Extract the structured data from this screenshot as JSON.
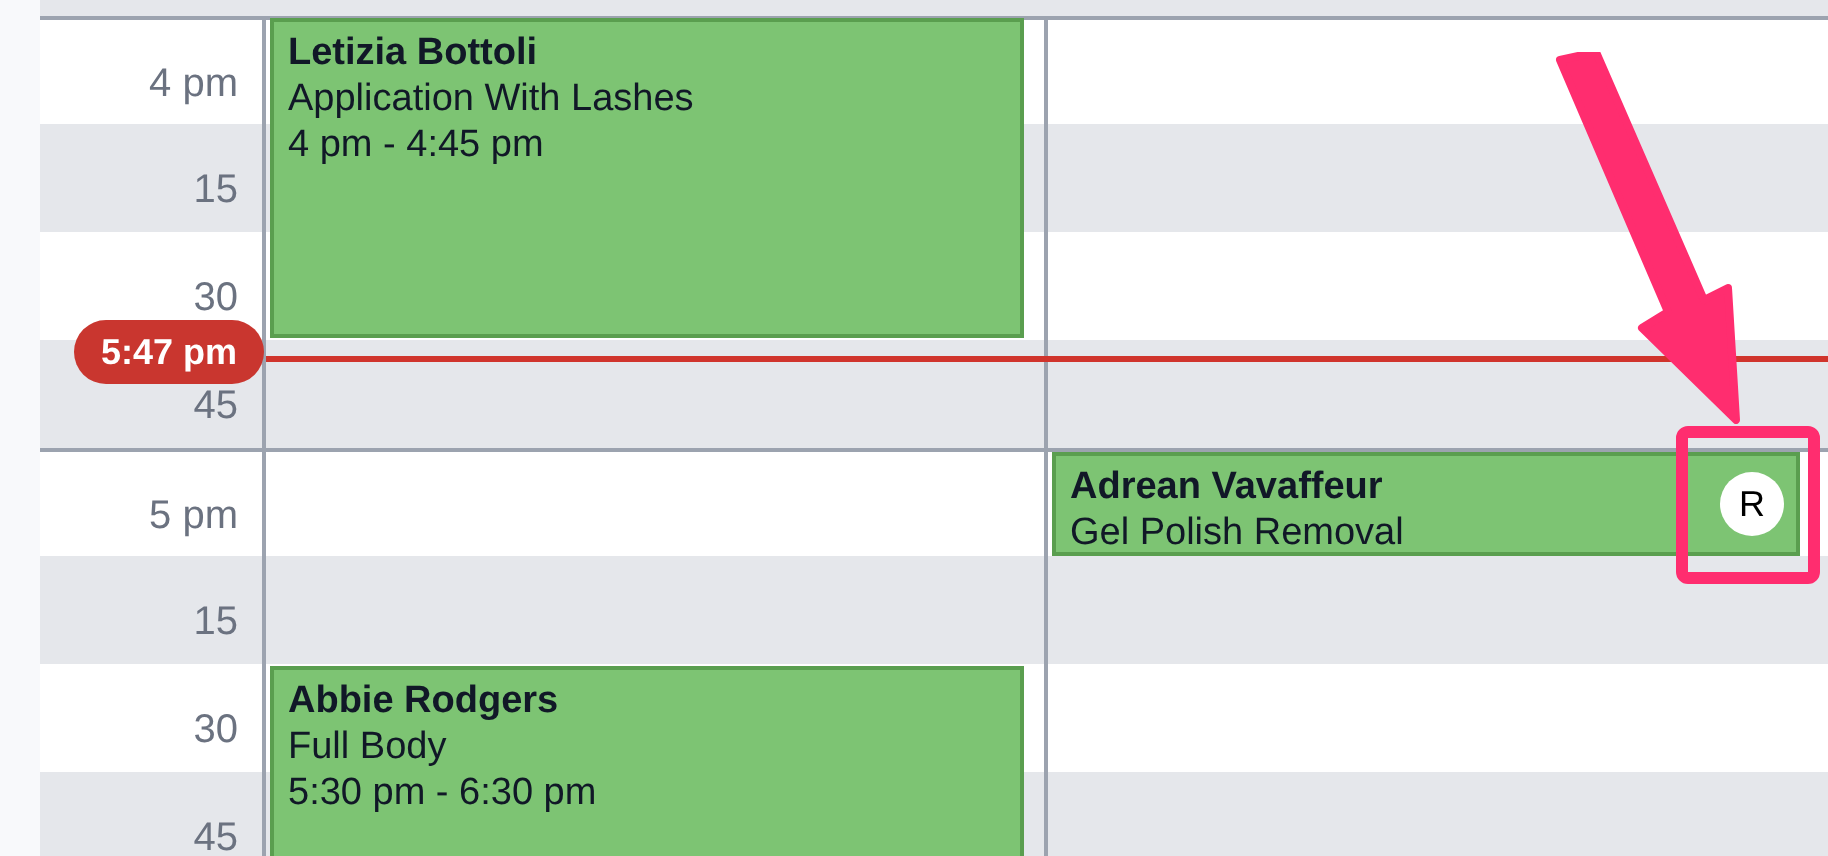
{
  "time_slots": [
    {
      "label": "4 pm",
      "kind": "hour"
    },
    {
      "label": "15",
      "kind": "quarter"
    },
    {
      "label": "30",
      "kind": "quarter"
    },
    {
      "label": "45",
      "kind": "quarter"
    },
    {
      "label": "5 pm",
      "kind": "hour"
    },
    {
      "label": "15",
      "kind": "quarter"
    },
    {
      "label": "30",
      "kind": "quarter"
    },
    {
      "label": "45",
      "kind": "quarter"
    }
  ],
  "now_marker": "5:47 pm",
  "appointments": [
    {
      "client": "Letizia Bottoli",
      "service": "Application With Lashes",
      "time": "4 pm - 4:45 pm"
    },
    {
      "client": "Adrean Vavaffeur",
      "service": "Gel Polish Removal",
      "badge": "R"
    },
    {
      "client": "Abbie Rodgers",
      "service": "Full Body",
      "time": "5:30 pm - 6:30 pm"
    }
  ]
}
